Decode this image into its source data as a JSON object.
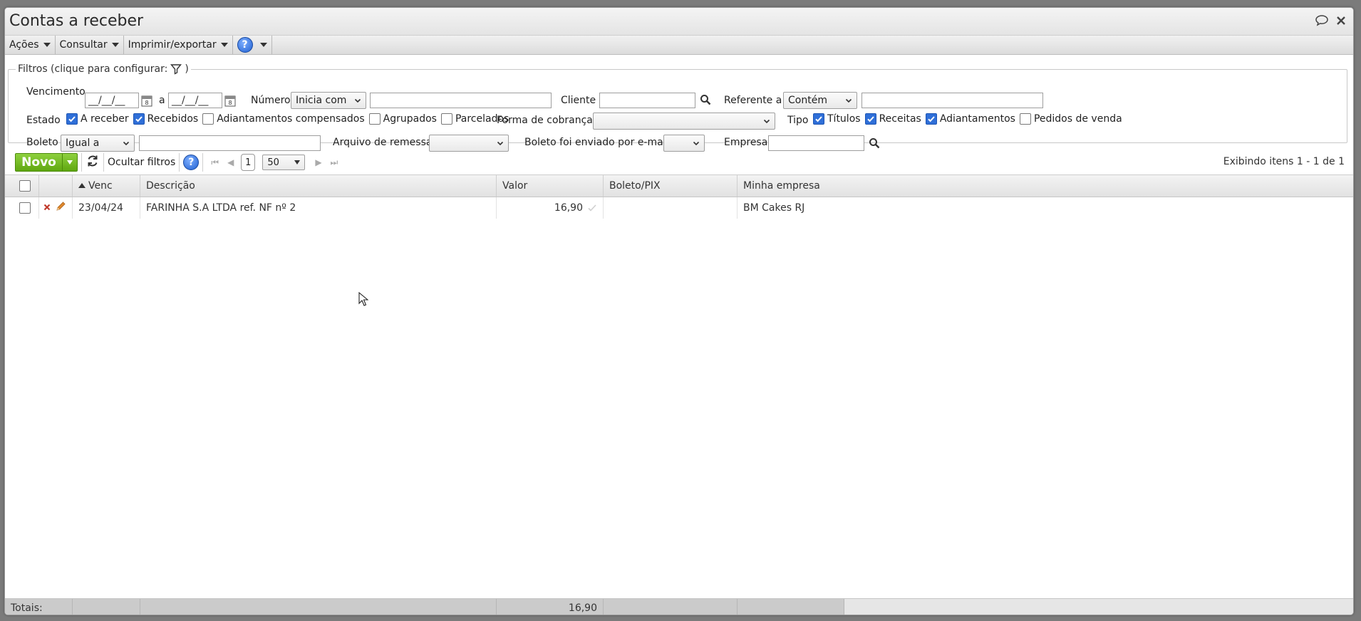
{
  "window": {
    "title": "Contas a receber"
  },
  "menu": {
    "actions": "Ações",
    "consult": "Consultar",
    "print": "Imprimir/exportar",
    "help": "?"
  },
  "filters": {
    "legend": "Filtros (clique para configurar:",
    "legend_close": ")",
    "vencimento_label": "Vencimento",
    "date_from": "__/__/__",
    "date_sep": "a",
    "date_to": "__/__/__",
    "numero_label": "Número",
    "numero_op": "Inicia com",
    "numero_value": "",
    "cliente_label": "Cliente",
    "cliente_value": "",
    "referente_label": "Referente a",
    "referente_op": "Contém",
    "referente_value": "",
    "estado_label": "Estado",
    "estado": [
      {
        "label": "A receber",
        "checked": true
      },
      {
        "label": "Recebidos",
        "checked": true
      },
      {
        "label": "Adiantamentos compensados",
        "checked": false
      },
      {
        "label": "Agrupados",
        "checked": false
      },
      {
        "label": "Parcelados",
        "checked": false
      }
    ],
    "forma_label": "Forma de cobrança",
    "forma_value": "",
    "tipo_label": "Tipo",
    "tipo": [
      {
        "label": "Títulos",
        "checked": true
      },
      {
        "label": "Receitas",
        "checked": true
      },
      {
        "label": "Adiantamentos",
        "checked": true
      },
      {
        "label": "Pedidos de venda",
        "checked": false
      }
    ],
    "boleto_label": "Boleto",
    "boleto_op": "Igual a",
    "boleto_value": "",
    "arquivo_label": "Arquivo de remessa",
    "arquivo_value": "",
    "enviado_label": "Boleto foi enviado por e-mail",
    "enviado_value": "",
    "empresa_label": "Empresa",
    "empresa_value": ""
  },
  "toolbar": {
    "new_label": "Novo",
    "hide_filters": "Ocultar filtros",
    "page": "1",
    "page_size": "50",
    "showing": "Exibindo itens 1 - 1 de 1"
  },
  "grid": {
    "columns": {
      "venc": "Venc",
      "descricao": "Descrição",
      "valor": "Valor",
      "boleto": "Boleto/PIX",
      "empresa": "Minha empresa"
    },
    "rows": [
      {
        "venc": "23/04/24",
        "descricao": "FARINHA S.A LTDA ref. NF nº 2",
        "valor": "16,90",
        "boleto": "",
        "empresa": "BM Cakes RJ"
      }
    ],
    "totals_label": "Totais:",
    "totals_valor": "16,90"
  },
  "colors": {
    "accent_blue": "#2f6fd8",
    "new_green": "#6cb61d",
    "delete_red": "#c0392b",
    "edit_orange": "#e08a2e"
  }
}
